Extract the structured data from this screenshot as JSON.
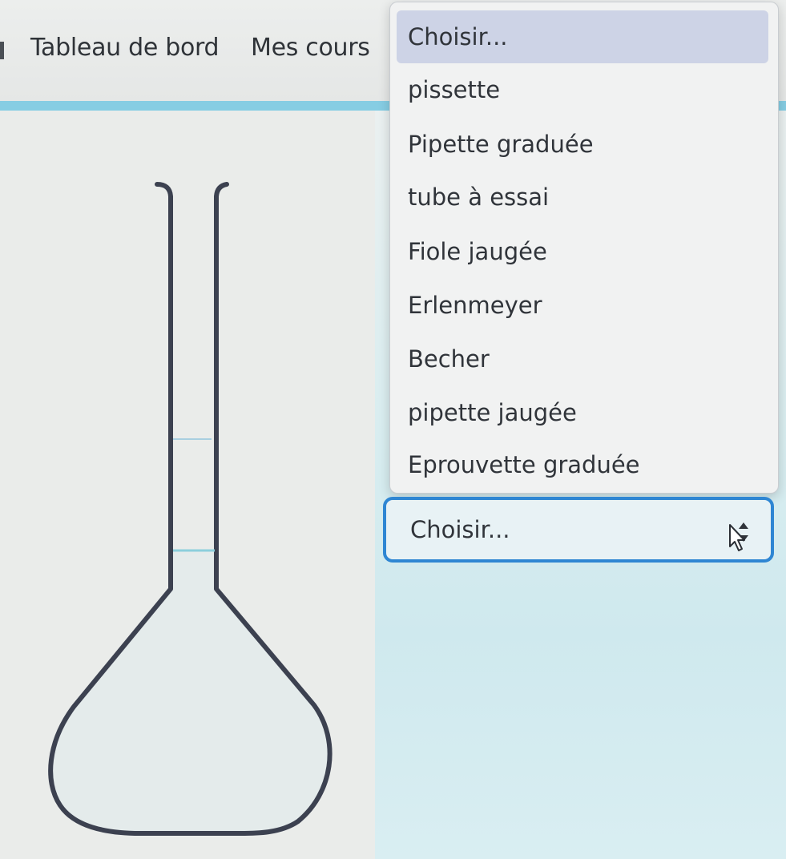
{
  "nav": {
    "items": [
      {
        "label": "Tableau de bord"
      },
      {
        "label": "Mes cours"
      }
    ]
  },
  "dropdown": {
    "options": [
      {
        "label": "Choisir...",
        "selected": true
      },
      {
        "label": "pissette"
      },
      {
        "label": "Pipette graduée"
      },
      {
        "label": "tube à essai"
      },
      {
        "label": "Fiole jaugée"
      },
      {
        "label": "Erlenmeyer"
      },
      {
        "label": "Becher"
      },
      {
        "label": "pipette jaugée"
      },
      {
        "label": "Eprouvette graduée"
      }
    ]
  },
  "select": {
    "value": "Choisir...",
    "icon": "up-down-arrows-icon"
  },
  "colors": {
    "accent": "#86cde3",
    "focus_border": "#2e86d3",
    "selected_option": "#cdd3e6",
    "flask_outline": "#3c4150",
    "liquid_line": "#8ccfdc"
  }
}
